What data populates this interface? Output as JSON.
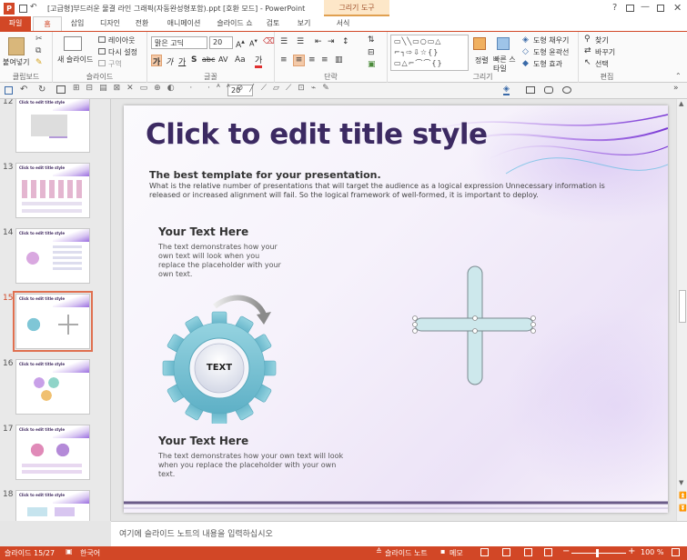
{
  "window": {
    "title": "[고급형]부드러운 물결 라인 그래픽(자동완성형포함).ppt [호환 모드] - PowerPoint",
    "context_tab_group": "그리기 도구",
    "help": "?"
  },
  "tabs": [
    "파일",
    "홈",
    "삽입",
    "디자인",
    "전환",
    "애니메이션",
    "슬라이드 쇼",
    "검토",
    "보기",
    "서식"
  ],
  "ribbon": {
    "clipboard": {
      "label": "클립보드",
      "paste": "붙여넣기"
    },
    "slides": {
      "label": "슬라이드",
      "new_slide": "새 슬라이드",
      "layout": "레이아웃",
      "reset": "다시 설정",
      "section": "구역"
    },
    "font": {
      "label": "글꼴",
      "font_name": "맑은 고딕",
      "font_size": "20",
      "shadow_btn": "가",
      "strike_btn": "abc",
      "spacing_btn": "AV",
      "case_btn": "Aa",
      "color_btn": "가"
    },
    "paragraph": {
      "label": "단락"
    },
    "drawing": {
      "label": "그리기",
      "arrange": "정렬",
      "quick_styles": "빠른 스타일",
      "shape_fill": "도형 채우기",
      "shape_outline": "도형 윤곽선",
      "shape_effects": "도형 효과"
    },
    "editing": {
      "label": "편집",
      "find": "찾기",
      "replace": "바꾸기",
      "select": "선택"
    }
  },
  "qat": {
    "font_size": "20"
  },
  "thumbnails": [
    {
      "num": "12",
      "title": "Click to edit title style"
    },
    {
      "num": "13",
      "title": "Click to edit title style"
    },
    {
      "num": "14",
      "title": "Click to edit title style"
    },
    {
      "num": "15",
      "title": "Click to edit title style"
    },
    {
      "num": "16",
      "title": "Click to edit title style"
    },
    {
      "num": "17",
      "title": "Click to edit title style"
    },
    {
      "num": "18",
      "title": "Click to edit title style"
    }
  ],
  "slide": {
    "title": "Click to edit title style",
    "subtitle": "The best template for your presentation.",
    "body": "What is the relative number of presentations that will target the audience as a logical expression Unnecessary information is released or increased alignment will fail. So the logical framework of well-formed, it is important to deploy.",
    "block1_heading": "Your Text Here",
    "block1_text": "The text demonstrates how your own text will look when you replace the placeholder with your own text.",
    "gear_label": "TEXT",
    "block2_heading": "Your Text Here",
    "block2_text": "The text demonstrates how your own text will look when you replace the placeholder with your own text."
  },
  "notes_placeholder": "여기에 슬라이드 노트의 내용을 입력하십시오",
  "status": {
    "slide_info": "슬라이드 15/27",
    "language": "한국어",
    "notes": "슬라이드 노트",
    "comments": "메모",
    "zoom": "100 %"
  },
  "colors": {
    "accent": "#d24726",
    "title": "#3c2a62",
    "gear": "#7fc6d6",
    "cross_fill": "#cde8ec"
  }
}
